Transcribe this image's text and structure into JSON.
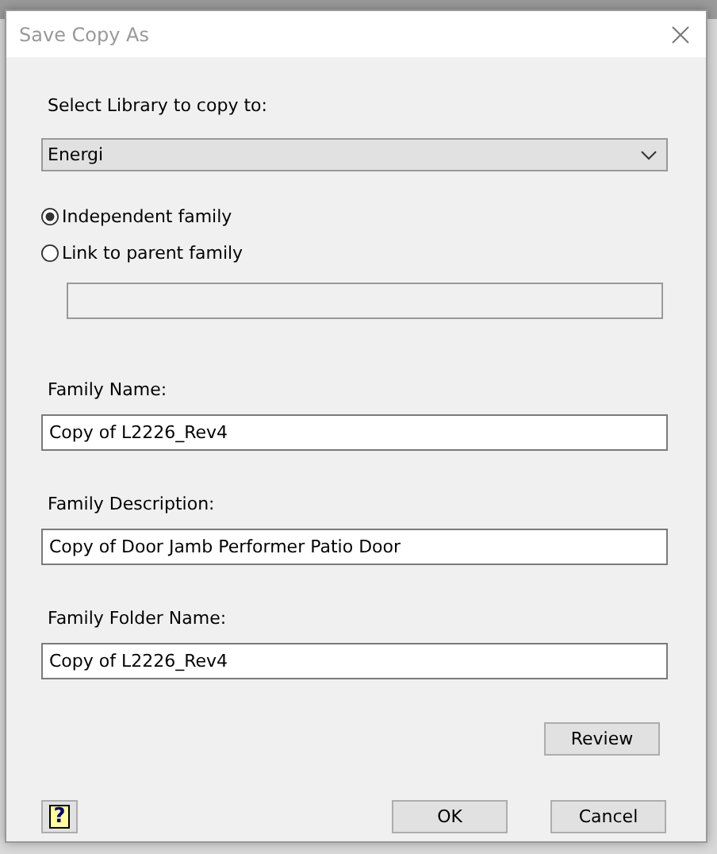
{
  "window": {
    "title": "Save Copy As"
  },
  "library": {
    "label": "Select Library to copy to:",
    "value": "Energi"
  },
  "options": [
    {
      "label": "Independent family",
      "selected": true
    },
    {
      "label": "Link to parent family",
      "selected": false
    }
  ],
  "parent_field": {
    "disabled": true
  },
  "fields": [
    {
      "label": "Family Name:",
      "value": "Copy of L2226_Rev4"
    },
    {
      "label": "Family Description:",
      "value": "Copy of Door Jamb Performer Patio Door"
    },
    {
      "label": "Family Folder Name:",
      "value": "Copy of L2226_Rev4"
    }
  ],
  "review_button": "Review",
  "help_button": "?",
  "buttons": [
    "OK",
    "Cancel"
  ]
}
